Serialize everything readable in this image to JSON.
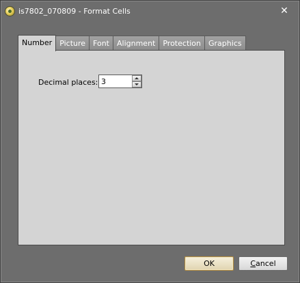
{
  "window": {
    "title": "is7802_070809 - Format Cells",
    "app_icon": "spreadsheet-app-icon",
    "close_glyph": "✕"
  },
  "tabs": [
    {
      "label": "Number",
      "active": true
    },
    {
      "label": "Picture",
      "active": false
    },
    {
      "label": "Font",
      "active": false
    },
    {
      "label": "Alignment",
      "active": false
    },
    {
      "label": "Protection",
      "active": false
    },
    {
      "label": "Graphics",
      "active": false
    }
  ],
  "number_tab": {
    "decimal_places_label": "Decimal places:",
    "decimal_places_value": "3"
  },
  "buttons": {
    "ok": "OK",
    "cancel_first": "C",
    "cancel_rest": "ancel"
  },
  "colors": {
    "chrome": "#6d6d6d",
    "panel": "#d4d4d4",
    "ok_border": "#b08a40"
  }
}
